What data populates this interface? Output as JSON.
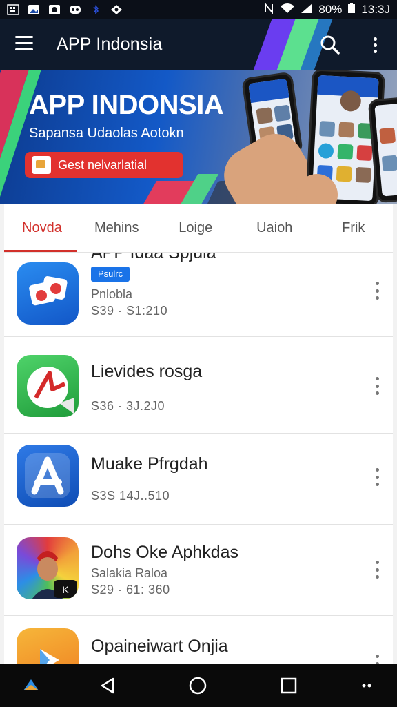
{
  "status_bar": {
    "battery_percent": "80%",
    "time": "13:3J"
  },
  "app_bar": {
    "title": "APP Indonsia",
    "icons": [
      "menu-icon",
      "search-icon",
      "more-vert-icon"
    ]
  },
  "banner": {
    "title": "APP INDONSIA",
    "subtitle": "Sapansa Udaolas Aotokn",
    "cta_label": "Gest nelvarlatial"
  },
  "tabs": [
    {
      "label": "Novda",
      "active": true
    },
    {
      "label": "Mehins",
      "active": false
    },
    {
      "label": "Loige",
      "active": false
    },
    {
      "label": "Uaioh",
      "active": false
    },
    {
      "label": "Frik",
      "active": false
    }
  ],
  "apps": [
    {
      "name": "APP Idaa Spjula",
      "badge": "Psulrc",
      "subtitle": "Pnlobla",
      "meta": "S39 · S1:210",
      "icon": "photo-app-icon"
    },
    {
      "name": "Lievides rosga",
      "subtitle": "",
      "meta": "S36 · 3J.2J0",
      "icon": "map-pin-app-icon"
    },
    {
      "name": "Muake Pfrgdah",
      "subtitle": "",
      "meta": "S3S 14J..510",
      "icon": "app-store-icon"
    },
    {
      "name": "Dohs Oke Aphkdas",
      "subtitle": "Salakia Raloa",
      "meta": "S29 · 61: 360",
      "icon": "avatar-game-icon"
    },
    {
      "name": "Opaineiwart Onjia",
      "subtitle": "",
      "meta": "",
      "icon": "play-app-icon"
    }
  ],
  "colors": {
    "accent": "#d2302b",
    "app_bar": "#0f1a2b",
    "badge": "#1a73e8"
  }
}
